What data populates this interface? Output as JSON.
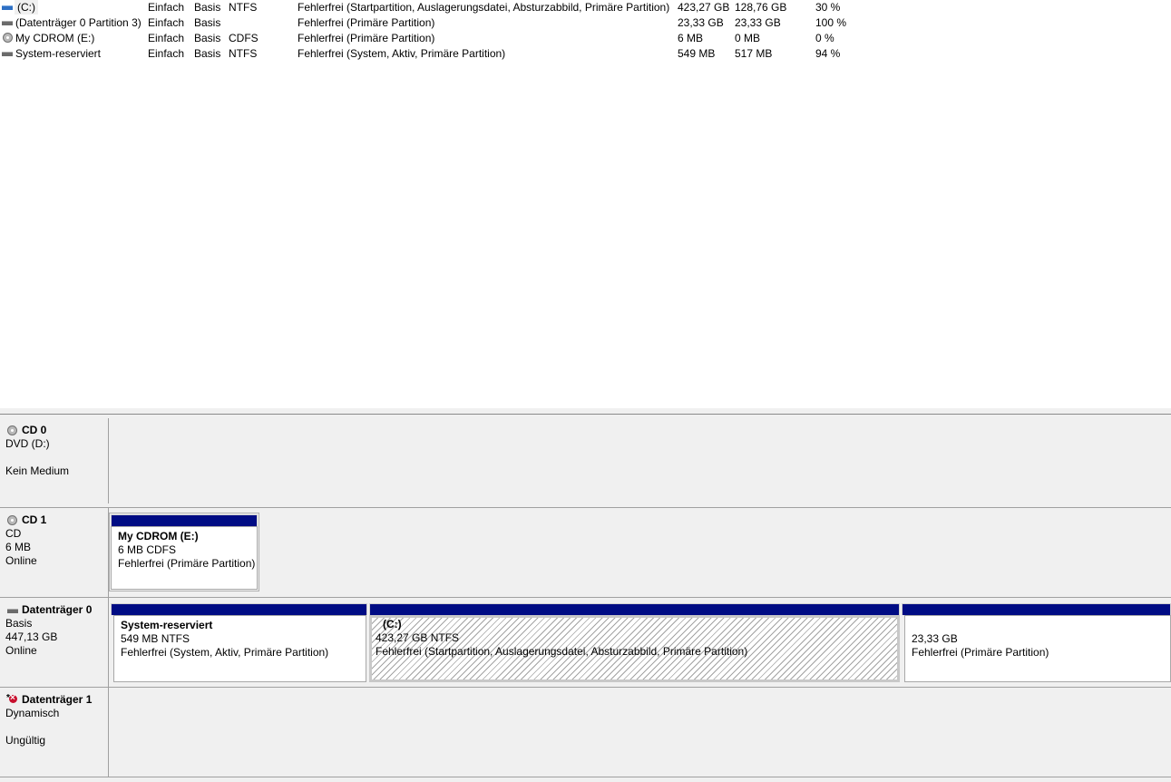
{
  "volumes": [
    {
      "name": "(C:)",
      "layout": "Einfach",
      "type": "Basis",
      "fs": "NTFS",
      "status": "Fehlerfrei (Startpartition, Auslagerungsdatei, Absturzabbild, Primäre Partition)",
      "capacity": "423,27 GB",
      "free": "128,76 GB",
      "pct_free": "30 %",
      "icon": "blue-drive-icon"
    },
    {
      "name": "(Datenträger 0 Partition 3)",
      "layout": "Einfach",
      "type": "Basis",
      "fs": "",
      "status": "Fehlerfrei (Primäre Partition)",
      "capacity": "23,33 GB",
      "free": "23,33 GB",
      "pct_free": "100 %",
      "icon": "drive-icon"
    },
    {
      "name": "My CDROM (E:)",
      "layout": "Einfach",
      "type": "Basis",
      "fs": "CDFS",
      "status": "Fehlerfrei (Primäre Partition)",
      "capacity": "6 MB",
      "free": "0 MB",
      "pct_free": "0 %",
      "icon": "cd-icon"
    },
    {
      "name": "System-reserviert",
      "layout": "Einfach",
      "type": "Basis",
      "fs": "NTFS",
      "status": "Fehlerfrei (System, Aktiv, Primäre Partition)",
      "capacity": "549 MB",
      "free": "517 MB",
      "pct_free": "94 %",
      "icon": "drive-icon"
    }
  ],
  "disks": {
    "cd0": {
      "title": "CD 0",
      "line1": "DVD (D:)",
      "line2": "",
      "line3": "Kein Medium"
    },
    "cd1": {
      "title": "CD 1",
      "line1": "CD",
      "line2": "6 MB",
      "line3": "Online",
      "partitions": [
        {
          "title": "My CDROM  (E:)",
          "size": "6 MB CDFS",
          "status": "Fehlerfrei (Primäre Partition)"
        }
      ]
    },
    "disk0": {
      "title": "Datenträger 0",
      "line1": "Basis",
      "line2": "447,13 GB",
      "line3": "Online",
      "partitions": [
        {
          "title": "System-reserviert",
          "size": "549 MB NTFS",
          "status": "Fehlerfrei (System, Aktiv, Primäre Partition)"
        },
        {
          "title": "(C:)",
          "size": "423,27 GB NTFS",
          "status": "Fehlerfrei (Startpartition, Auslagerungsdatei, Absturzabbild, Primäre Partition)"
        },
        {
          "title": "",
          "size": "23,33 GB",
          "status": "Fehlerfrei (Primäre Partition)"
        }
      ]
    },
    "disk1": {
      "title": "Datenträger 1",
      "line1": "Dynamisch",
      "line2": "",
      "line3": "Ungültig"
    }
  },
  "colors": {
    "partition_bar": "#000c84",
    "pane_bg": "#f0f0f0",
    "error_icon": "#c8102e"
  }
}
